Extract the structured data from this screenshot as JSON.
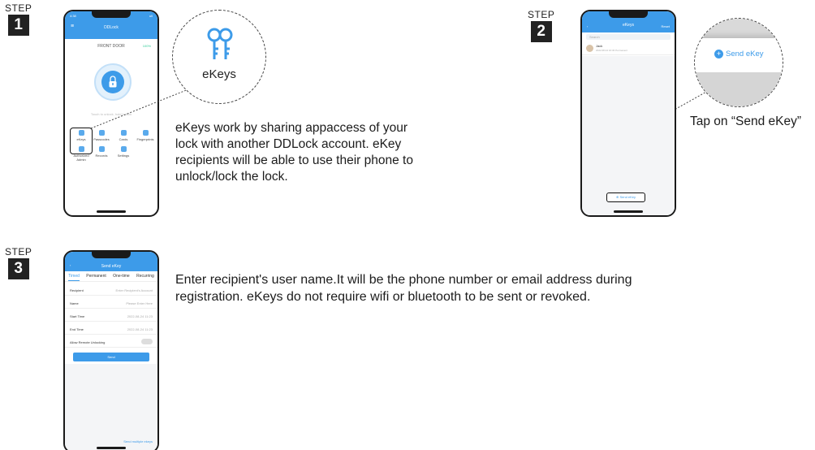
{
  "step1": {
    "label": "STEP",
    "number": "1",
    "phone": {
      "status_time": "4:38",
      "status_right": "ull",
      "title": "DDLock",
      "door": "FRONT DOOR",
      "battery": "100%",
      "hint": "Touch to unlock, hold to lock",
      "grid": [
        "eKeys",
        "Passcodes",
        "Cards",
        "Fingerprints",
        "Authorized Admin",
        "Records",
        "Settings"
      ]
    },
    "zoom_label": "eKeys",
    "description": [
      "eKeys work by sharing appaccess of your",
      "lock with another DDLock account. eKey",
      "recipients will be able to use their phone to",
      "unlock/lock the lock."
    ]
  },
  "step2": {
    "label": "STEP",
    "number": "2",
    "phone": {
      "title": "eKeys",
      "reset": "Reset",
      "search_placeholder": "Search",
      "row_name": "Jack",
      "row_sub": "2022.08.24 16:30 Permanent",
      "send_button": "Send eKey"
    },
    "zoom_button": "Send eKey",
    "description": "Tap on “Send eKey”"
  },
  "step3": {
    "label": "STEP",
    "number": "3",
    "phone": {
      "title": "Send eKey",
      "tabs": [
        "Timed",
        "Permanent",
        "One-time",
        "Recurring"
      ],
      "rows": [
        {
          "key": "Recipient",
          "value": "Enter Recipient's Account"
        },
        {
          "key": "Name",
          "value": "Please Enter Here"
        },
        {
          "key": "Start Time",
          "value": "2022-08-24 11:23"
        },
        {
          "key": "End Time",
          "value": "2022-08-24 11:23"
        },
        {
          "key": "Allow Remote Unlocking",
          "value": ""
        }
      ],
      "send": "Send",
      "multi": "Send multiple ekeys"
    },
    "description": [
      "Enter recipient's user name.It will be the phone number or email address during",
      "registration. eKeys do not require wifi or bluetooth to be sent or revoked."
    ]
  },
  "colors": {
    "accent": "#3d9be9",
    "ink": "#1c1c1c",
    "step_box": "#222222"
  }
}
